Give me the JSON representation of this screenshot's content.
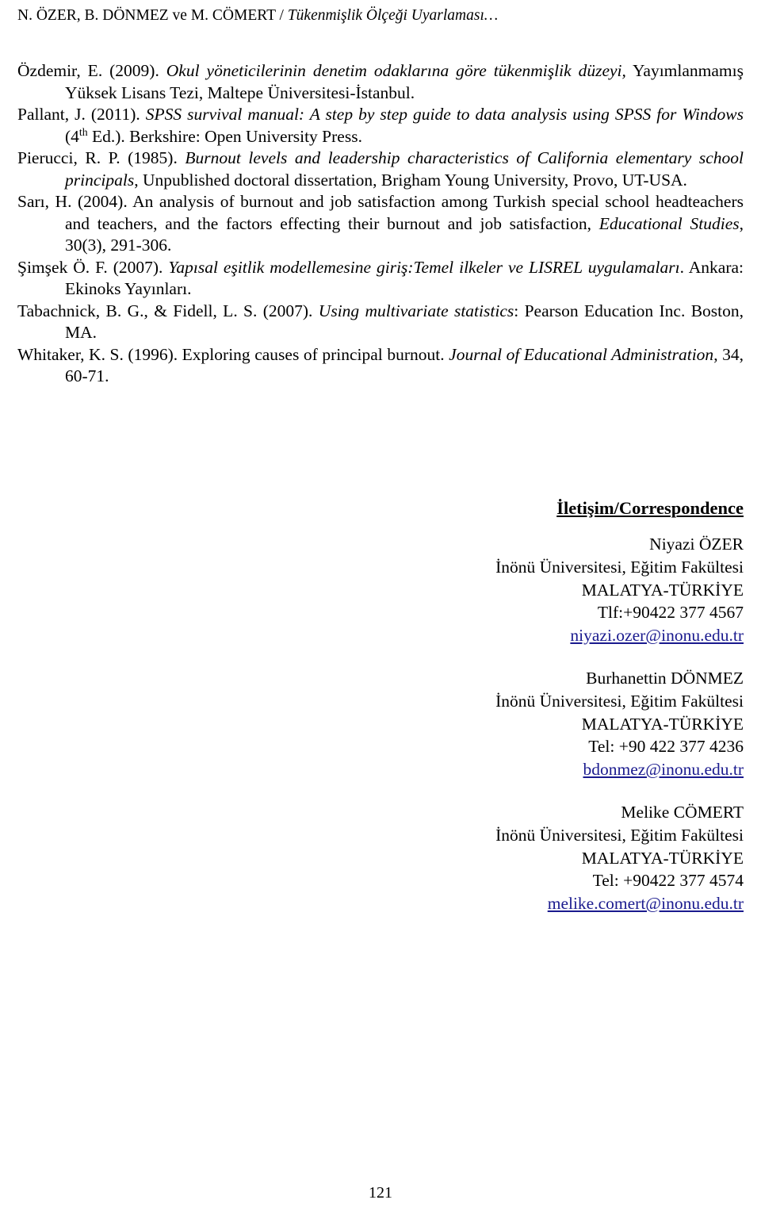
{
  "header": {
    "authors": "N. ÖZER, B. DÖNMEZ ve M. CÖMERT / ",
    "title": "Tükenmişlik Ölçeği Uyarlaması…"
  },
  "references": [
    {
      "id": "ozdemir-2009",
      "parts": [
        {
          "text": "Özdemir, E. (2009). ",
          "style": "normal"
        },
        {
          "text": "Okul yöneticilerinin denetim odaklarına göre tükenmişlik düzeyi,",
          "style": "italic"
        },
        {
          "text": " Yayımlanmamış Yüksek Lisans Tezi, Maltepe Üniversitesi-İstanbul.",
          "style": "normal"
        }
      ]
    },
    {
      "id": "pallant-2011",
      "parts": [
        {
          "text": "Pallant, J. (2011). ",
          "style": "normal"
        },
        {
          "text": "SPSS survival manual: A step by step guide to data analysis using SPSS for Windows",
          "style": "italic"
        },
        {
          "text": " (4",
          "style": "normal"
        },
        {
          "text": "th",
          "style": "superscript"
        },
        {
          "text": " Ed.). Berkshire: Open University Press.",
          "style": "normal"
        }
      ]
    },
    {
      "id": "pierucci-1985",
      "parts": [
        {
          "text": "Pierucci, R. P. (1985). ",
          "style": "normal"
        },
        {
          "text": "Burnout levels and leadership characteristics of California elementary school principals",
          "style": "italic"
        },
        {
          "text": ", Unpublished doctoral dissertation, Brigham Young University, Provo, UT-USA.",
          "style": "normal"
        }
      ]
    },
    {
      "id": "sari-2004",
      "parts": [
        {
          "text": "Sarı, H. (2004). An analysis of burnout and job satisfaction among Turkish special school headteachers and teachers, and the factors effecting their burnout and job satisfaction, ",
          "style": "normal"
        },
        {
          "text": "Educational Studies",
          "style": "italic"
        },
        {
          "text": ", 30(3), 291-306.",
          "style": "normal"
        }
      ]
    },
    {
      "id": "simsek-2007",
      "parts": [
        {
          "text": "Şimşek Ö. F. (2007). ",
          "style": "normal"
        },
        {
          "text": "Yapısal eşitlik modellemesine giriş:Temel ilkeler ve LISREL uygulamaları",
          "style": "italic"
        },
        {
          "text": ". Ankara: Ekinoks Yayınları.",
          "style": "normal"
        }
      ]
    },
    {
      "id": "tabachnick-2007",
      "parts": [
        {
          "text": "Tabachnick, B. G., & Fidell, L. S. (2007). ",
          "style": "normal"
        },
        {
          "text": "Using multivariate statistics",
          "style": "italic"
        },
        {
          "text": ": Pearson Education Inc. Boston, MA.",
          "style": "normal"
        }
      ]
    },
    {
      "id": "whitaker-1996",
      "parts": [
        {
          "text": "Whitaker, K. S. (1996). Exploring causes of principal burnout. ",
          "style": "normal"
        },
        {
          "text": "Journal of Educational Administration",
          "style": "italic"
        },
        {
          "text": ", 34, 60-71.",
          "style": "normal"
        }
      ]
    }
  ],
  "correspondence": {
    "heading": "İletişim/Correspondence",
    "link_color": "#1a1a8e",
    "contacts": [
      {
        "name": "Niyazi ÖZER",
        "affiliation": "İnönü Üniversitesi, Eğitim Fakültesi",
        "city": "MALATYA-TÜRKİYE",
        "phone": "Tlf:+90422 377 4567",
        "email": "niyazi.ozer@inonu.edu.tr"
      },
      {
        "name": "Burhanettin DÖNMEZ",
        "affiliation": "İnönü Üniversitesi, Eğitim Fakültesi",
        "city": "MALATYA-TÜRKİYE",
        "phone": "Tel: +90 422 377 4236",
        "email": "bdonmez@inonu.edu.tr"
      },
      {
        "name": "Melike CÖMERT",
        "affiliation": "İnönü Üniversitesi, Eğitim Fakültesi",
        "city": "MALATYA-TÜRKİYE",
        "phone": "Tel: +90422 377 4574",
        "email": "melike.comert@inonu.edu.tr"
      }
    ]
  },
  "footer": {
    "page_number": "121"
  }
}
